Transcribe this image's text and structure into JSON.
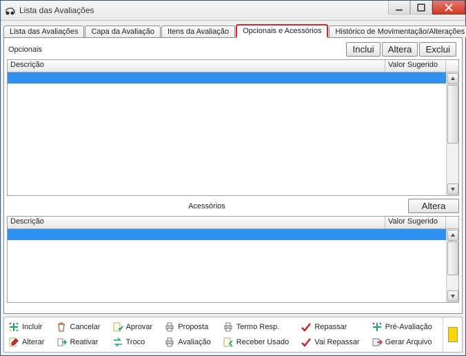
{
  "window": {
    "title": "Lista das Avaliações"
  },
  "tabs": [
    "Lista das Avaliações",
    "Capa da Avaliação",
    "Itens da Avaliação",
    "Opcionais e Acessórios",
    "Histórico de Movimentação/Alterações"
  ],
  "opcionais": {
    "title": "Opcionais",
    "buttons": {
      "inclui": "Inclui",
      "altera": "Altera",
      "exclui": "Exclui"
    },
    "columns": {
      "descricao": "Descrição",
      "valor": "Valor Sugerido"
    },
    "rows": [
      {
        "descricao": "",
        "valor": ""
      }
    ]
  },
  "acessorios": {
    "title": "Acessórios",
    "buttons": {
      "altera": "Altera"
    },
    "columns": {
      "descricao": "Descrição",
      "valor": "Valor Sugerido"
    },
    "rows": [
      {
        "descricao": "",
        "valor": ""
      }
    ]
  },
  "footer": {
    "incluir": "Incluir",
    "cancelar": "Cancelar",
    "aprovar": "Aprovar",
    "proposta": "Proposta",
    "termoresp": "Termo Resp.",
    "repassar": "Repassar",
    "preavaliacao": "Pré-Avaliação",
    "alterar": "Alterar",
    "reativar": "Reativar",
    "troco": "Troco",
    "avaliacao": "Avaliação",
    "receberusado": "Receber Usado",
    "vairepassar": "Vai Repassar",
    "gerararquivo": "Gerar Arquivo"
  }
}
